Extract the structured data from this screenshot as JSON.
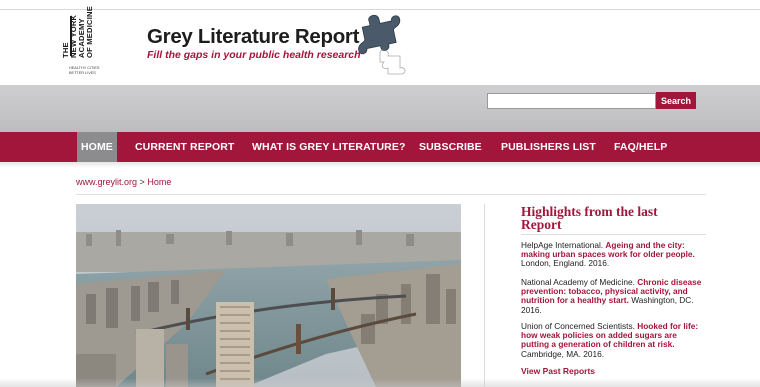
{
  "logo": {
    "lines": [
      "THE",
      "NEW YORK",
      "ACADEMY",
      "OF MEDICINE"
    ],
    "tagline_lines": [
      "HEALTHY CITIES",
      "BETTER LIVES"
    ]
  },
  "header": {
    "title": "Grey Literature Report",
    "tagline": "Fill the gaps in your public health research"
  },
  "search": {
    "placeholder": "",
    "value": "",
    "button_label": "Search"
  },
  "nav": {
    "items": [
      {
        "label": "HOME",
        "active": true
      },
      {
        "label": "CURRENT REPORT",
        "active": false
      },
      {
        "label": "WHAT IS GREY LITERATURE?",
        "active": false
      },
      {
        "label": "SUBSCRIBE",
        "active": false
      },
      {
        "label": "PUBLISHERS LIST",
        "active": false
      },
      {
        "label": "FAQ/HELP",
        "active": false
      }
    ]
  },
  "breadcrumb": {
    "root": "www.greylit.org",
    "separator": ">",
    "current": "Home"
  },
  "sidebar": {
    "title": "Highlights from the last Report",
    "entries": [
      {
        "publisher": "HelpAge International.",
        "link": "Ageing and the city: making urban spaces work for older people.",
        "meta": "London, England. 2016."
      },
      {
        "publisher": "National Academy of Medicine.",
        "link": "Chronic disease prevention: tobacco, physical activity, and nutrition for a healthy start.",
        "meta": "Washington, DC. 2016."
      },
      {
        "publisher": "Union of Concerned Scientists.",
        "link": "Hooked for life: how weak policies on added sugars are putting a generation of children at risk.",
        "meta": "Cambridge, MA. 2016."
      }
    ],
    "view_past": "View Past Reports"
  },
  "colors": {
    "brand": "#a3163b",
    "nav_active": "#8c8c8e",
    "band": "#c6c6c8"
  }
}
